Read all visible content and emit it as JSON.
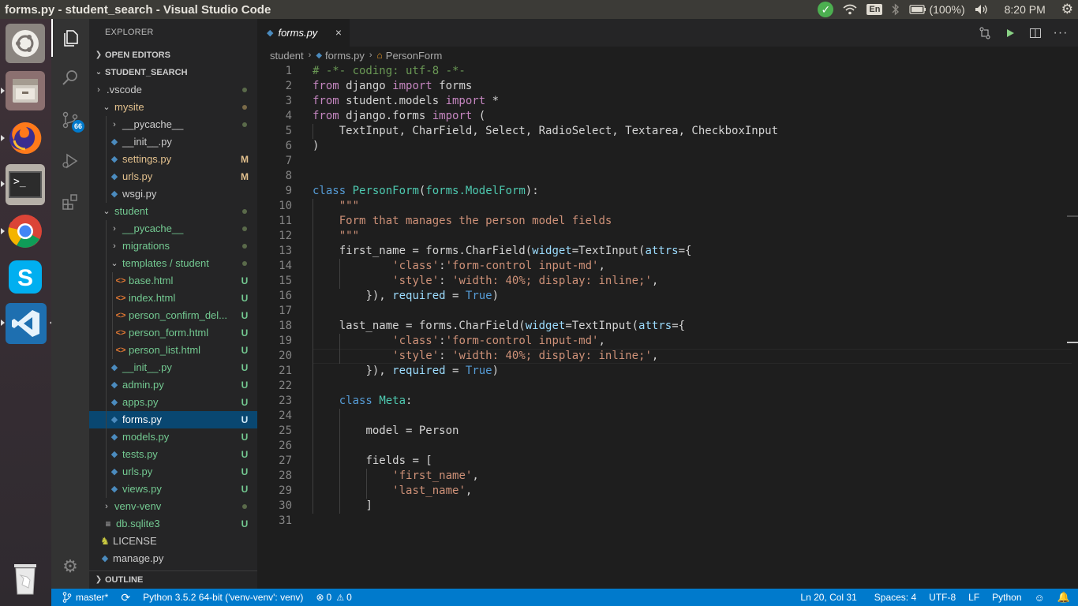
{
  "window_title": "forms.py - student_search - Visual Studio Code",
  "tray": {
    "wifi_icon": "wifi-icon",
    "language": "En",
    "battery": "(100%)",
    "volume_icon": "volume-icon",
    "time": "8:20 PM"
  },
  "colors": {
    "statusbar": "#007acc",
    "selection": "#094771",
    "untracked": "#73c991",
    "modified": "#e2c08d"
  },
  "explorer": {
    "title": "EXPLORER",
    "open_editors": "OPEN EDITORS",
    "project": "STUDENT_SEARCH",
    "outline": "OUTLINE",
    "files": {
      "vscode": ".vscode",
      "mysite": "mysite",
      "mysite_pycache": "__pycache__",
      "mysite_init": "__init__.py",
      "settings": "settings.py",
      "settings_badge": "M",
      "urls_mysite": "urls.py",
      "urls_mysite_badge": "M",
      "wsgi": "wsgi.py",
      "student": "student",
      "student_pycache": "__pycache__",
      "migrations": "migrations",
      "templates": "templates / student",
      "base": "base.html",
      "index": "index.html",
      "confirm": "person_confirm_del...",
      "person_form": "person_form.html",
      "person_list": "person_list.html",
      "student_init": "__init__.py",
      "admin": "admin.py",
      "apps": "apps.py",
      "forms": "forms.py",
      "models": "models.py",
      "tests": "tests.py",
      "urls_student": "urls.py",
      "views": "views.py",
      "venv": "venv-venv",
      "db": "db.sqlite3",
      "license": "LICENSE",
      "manage": "manage.py",
      "u": "U"
    }
  },
  "activity": {
    "scm_badge": "66"
  },
  "tab": {
    "label": "forms.py",
    "close": "×"
  },
  "breadcrumbs": {
    "folder": "student",
    "file": "forms.py",
    "symbol": "PersonForm"
  },
  "code": {
    "line_numbers": [
      "1",
      "2",
      "3",
      "4",
      "5",
      "6",
      "7",
      "8",
      "9",
      "10",
      "11",
      "12",
      "13",
      "14",
      "15",
      "16",
      "17",
      "18",
      "19",
      "20",
      "21",
      "22",
      "23",
      "24",
      "25",
      "26",
      "27",
      "28",
      "29",
      "30",
      "31"
    ],
    "l1": "# -*- coding: utf-8 -*-",
    "from": "from",
    "import": "import",
    "django": " django ",
    "forms": " forms",
    "student_models": " student.models ",
    "star": " *",
    "django_forms": " django.forms ",
    "paren_open": " (",
    "l5": "    TextInput, CharField, Select, RadioSelect, Textarea, CheckboxInput",
    "l6": ")",
    "class": "class",
    "sp": " ",
    "PersonForm": "PersonForm",
    "lp": "(",
    "forms_dot": "forms.",
    "ModelForm": "ModelForm",
    "rp_colon": "):",
    "indent4": "    ",
    "indent8": "        ",
    "indent12": "            ",
    "triple": "\"\"\"",
    "l11": "Form that manages the person model fields",
    "first_name_assign": "first_name = forms.CharField(",
    "last_name_assign": "last_name = forms.CharField(",
    "widget": "widget",
    "eq_textinput": "=TextInput(",
    "attrs": "attrs",
    "eq_brace": "={",
    "class_str": "'class'",
    "colon": ":",
    "fc_str": "'form-control input-md'",
    "comma": ",",
    "style_str": "'style'",
    "colon_sp": ": ",
    "width_str": "'width: 40%; display: inline;'",
    "close_brace": "}), ",
    "required": "required",
    "eq_sp": " = ",
    "True": "True",
    "rparen": ")",
    "Meta": "Meta",
    "colon_only": ":",
    "model_assign": "model = Person",
    "fields_assign": "fields = [",
    "fn_str": "'first_name'",
    "ln_str": "'last_name'",
    "close_bracket": "]"
  },
  "status": {
    "branch": "master*",
    "python": "Python 3.5.2 64-bit ('venv-venv': venv)",
    "errors": "0",
    "warnings": "0",
    "position": "Ln 20, Col 31",
    "spaces": "Spaces: 4",
    "encoding": "UTF-8",
    "eol": "LF",
    "language": "Python"
  }
}
